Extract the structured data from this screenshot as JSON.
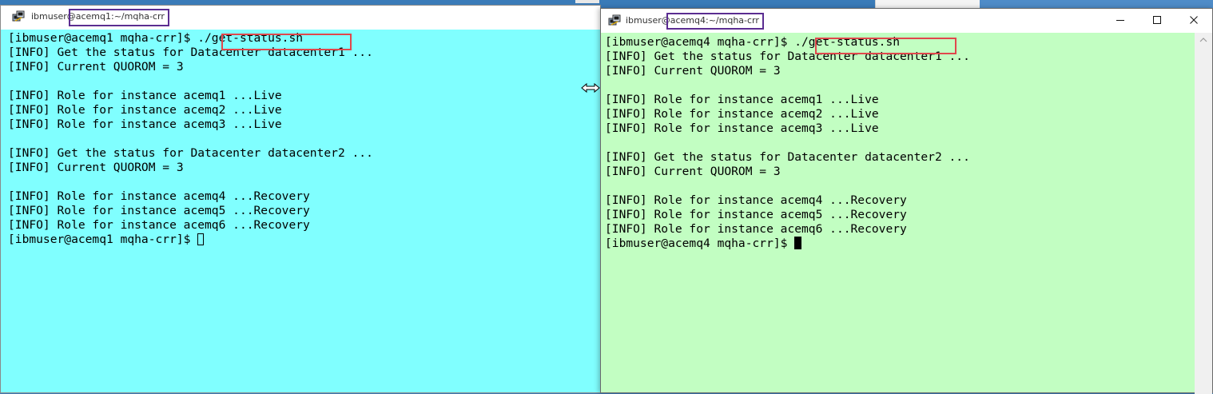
{
  "window_left": {
    "title_prefix": "ibmuser@",
    "title_highlight": "acemq1:~/mqha-crr",
    "background": "#80ffff",
    "command_highlight_color": "#e0474c",
    "title_highlight_color": "#5b2d91",
    "lines": [
      "[ibmuser@acemq1 mqha-crr]$ ./get-status.sh",
      "[INFO] Get the status for Datacenter datacenter1 ...",
      "[INFO] Current QUOROM = 3",
      "",
      "[INFO] Role for instance acemq1 ...Live",
      "[INFO] Role for instance acemq2 ...Live",
      "[INFO] Role for instance acemq3 ...Live",
      "",
      "[INFO] Get the status for Datacenter datacenter2 ...",
      "[INFO] Current QUOROM = 3",
      "",
      "[INFO] Role for instance acemq4 ...Recovery",
      "[INFO] Role for instance acemq5 ...Recovery",
      "[INFO] Role for instance acemq6 ...Recovery"
    ],
    "prompt": "[ibmuser@acemq1 mqha-crr]$ "
  },
  "window_right": {
    "title_prefix": "ibmuser@",
    "title_highlight": "acemq4:~/mqha-crr",
    "background": "#c2fec2",
    "lines": [
      "[ibmuser@acemq4 mqha-crr]$ ./get-status.sh",
      "[INFO] Get the status for Datacenter datacenter1 ...",
      "[INFO] Current QUOROM = 3",
      "",
      "[INFO] Role for instance acemq1 ...Live",
      "[INFO] Role for instance acemq2 ...Live",
      "[INFO] Role for instance acemq3 ...Live",
      "",
      "[INFO] Get the status for Datacenter datacenter2 ...",
      "[INFO] Current QUOROM = 3",
      "",
      "[INFO] Role for instance acemq4 ...Recovery",
      "[INFO] Role for instance acemq5 ...Recovery",
      "[INFO] Role for instance acemq6 ...Recovery"
    ],
    "prompt": "[ibmuser@acemq4 mqha-crr]$ ",
    "controls": [
      "minimize-icon",
      "maximize-icon",
      "close-icon"
    ]
  }
}
